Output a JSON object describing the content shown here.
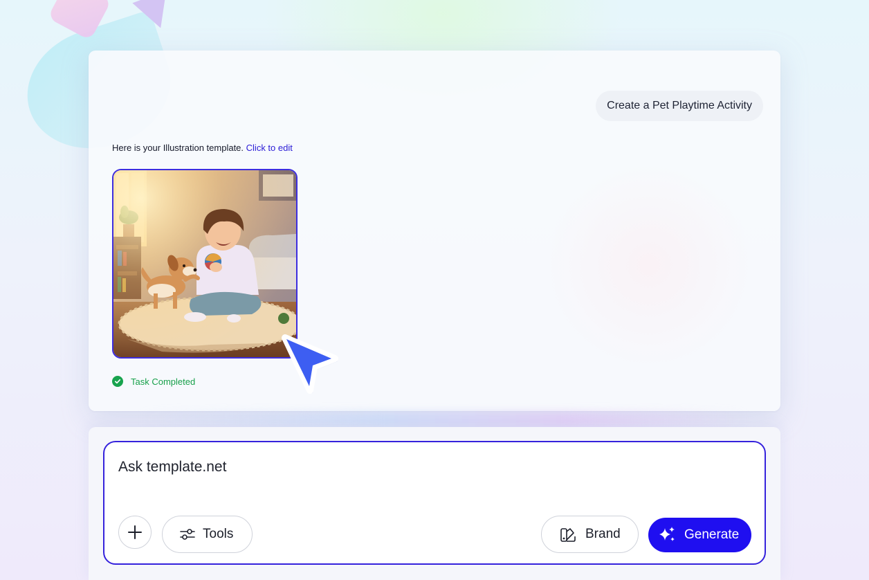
{
  "colors": {
    "accent": "#1f0ff0",
    "link": "#2a1bd6",
    "success": "#18a34e",
    "focus_border": "#3522dc"
  },
  "conversation": {
    "user_message": "Create a Pet Playtime Activity",
    "reply_text": "Here is your Illustration template.",
    "reply_link": "Click to edit",
    "status": "Task Completed",
    "status_icon": "check-circle-icon"
  },
  "composer": {
    "prompt": "Ask template.net",
    "add_icon": "plus-icon",
    "tools_label": "Tools",
    "tools_icon": "sliders-icon",
    "brand_label": "Brand",
    "brand_icon": "brand-palette-icon",
    "generate_label": "Generate",
    "generate_icon": "sparkles-icon"
  }
}
